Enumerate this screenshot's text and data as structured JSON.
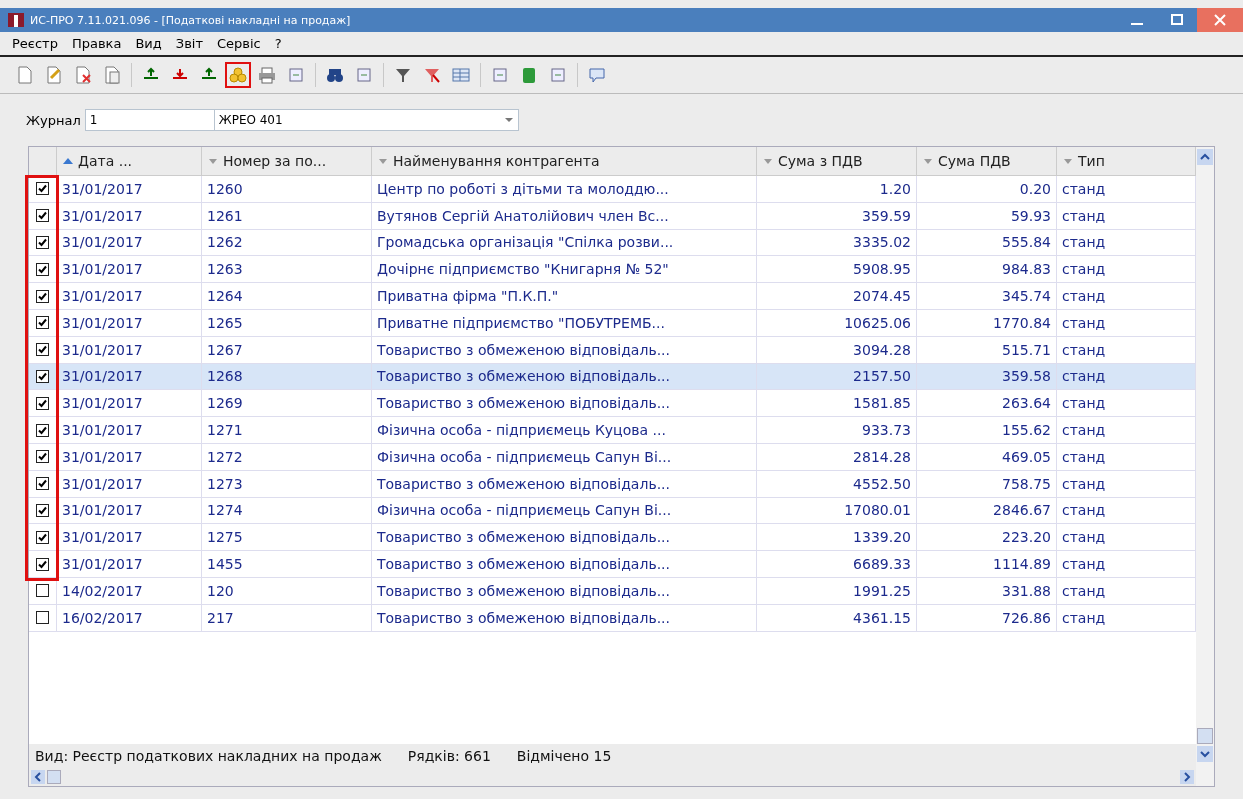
{
  "window": {
    "title": "ИС-ПРО 7.11.021.096 - [Податкові накладні на продаж]"
  },
  "menu": [
    "Реєстр",
    "Правка",
    "Вид",
    "Звіт",
    "Сервіс",
    "?"
  ],
  "journal": {
    "label": "Журнал",
    "number": "1",
    "name": "ЖРЕО 401"
  },
  "table": {
    "columns": [
      {
        "label": "Дата ...",
        "sorted": true
      },
      {
        "label": "Номер за по...",
        "sorted": false
      },
      {
        "label": "Найменування контрагента",
        "sorted": false
      },
      {
        "label": "Сума з ПДВ",
        "sorted": false
      },
      {
        "label": "Сума ПДВ",
        "sorted": false
      },
      {
        "label": "Тип",
        "sorted": false
      }
    ],
    "rows": [
      {
        "checked": true,
        "selected": false,
        "cells": [
          "31/01/2017",
          "1260",
          "Центр по роботі з дітьми та молоддю...",
          "1.20",
          "0.20",
          "станд"
        ]
      },
      {
        "checked": true,
        "selected": false,
        "cells": [
          "31/01/2017",
          "1261",
          "Вутянов Сергій Анатолійович член Вс...",
          "359.59",
          "59.93",
          "станд"
        ]
      },
      {
        "checked": true,
        "selected": false,
        "cells": [
          "31/01/2017",
          "1262",
          "Громадська організація \"Спілка розви...",
          "3335.02",
          "555.84",
          "станд"
        ]
      },
      {
        "checked": true,
        "selected": false,
        "cells": [
          "31/01/2017",
          "1263",
          "Дочірнє підприємство \"Книгарня № 52\"",
          "5908.95",
          "984.83",
          "станд"
        ]
      },
      {
        "checked": true,
        "selected": false,
        "cells": [
          "31/01/2017",
          "1264",
          "Приватна фірма \"П.К.П.\"",
          "2074.45",
          "345.74",
          "станд"
        ]
      },
      {
        "checked": true,
        "selected": false,
        "cells": [
          "31/01/2017",
          "1265",
          "Приватне підприємство \"ПОБУТРЕМБ...",
          "10625.06",
          "1770.84",
          "станд"
        ]
      },
      {
        "checked": true,
        "selected": false,
        "cells": [
          "31/01/2017",
          "1267",
          "Товариство з обмеженою відповідаль...",
          "3094.28",
          "515.71",
          "станд"
        ]
      },
      {
        "checked": true,
        "selected": true,
        "cells": [
          "31/01/2017",
          "1268",
          "Товариство з обмеженою відповідаль...",
          "2157.50",
          "359.58",
          "станд"
        ]
      },
      {
        "checked": true,
        "selected": false,
        "cells": [
          "31/01/2017",
          "1269",
          "Товариство з обмеженою відповідаль...",
          "1581.85",
          "263.64",
          "станд"
        ]
      },
      {
        "checked": true,
        "selected": false,
        "cells": [
          "31/01/2017",
          "1271",
          "Фізична особа - підприємець Куцова ...",
          "933.73",
          "155.62",
          "станд"
        ]
      },
      {
        "checked": true,
        "selected": false,
        "cells": [
          "31/01/2017",
          "1272",
          "Фізична особа - підприємець Сапун Ві...",
          "2814.28",
          "469.05",
          "станд"
        ]
      },
      {
        "checked": true,
        "selected": false,
        "cells": [
          "31/01/2017",
          "1273",
          "Товариство з обмеженою відповідаль...",
          "4552.50",
          "758.75",
          "станд"
        ]
      },
      {
        "checked": true,
        "selected": false,
        "cells": [
          "31/01/2017",
          "1274",
          "Фізична особа - підприємець Сапун Ві...",
          "17080.01",
          "2846.67",
          "станд"
        ]
      },
      {
        "checked": true,
        "selected": false,
        "cells": [
          "31/01/2017",
          "1275",
          "Товариство з обмеженою відповідаль...",
          "1339.20",
          "223.20",
          "станд"
        ]
      },
      {
        "checked": true,
        "selected": false,
        "cells": [
          "31/01/2017",
          "1455",
          "Товариство з обмеженою відповідаль...",
          "6689.33",
          "1114.89",
          "станд"
        ]
      },
      {
        "checked": false,
        "selected": false,
        "cells": [
          "14/02/2017",
          "120",
          "Товариство з обмеженою відповідаль...",
          "1991.25",
          "331.88",
          "станд"
        ]
      },
      {
        "checked": false,
        "selected": false,
        "cells": [
          "16/02/2017",
          "217",
          "Товариство з обмеженою відповідаль...",
          "4361.15",
          "726.86",
          "станд"
        ]
      }
    ]
  },
  "status_bar": {
    "view": "Вид: Реєстр податкових накладних на продаж",
    "rows": "Рядків: 661",
    "marked": "Відмічено 15"
  }
}
